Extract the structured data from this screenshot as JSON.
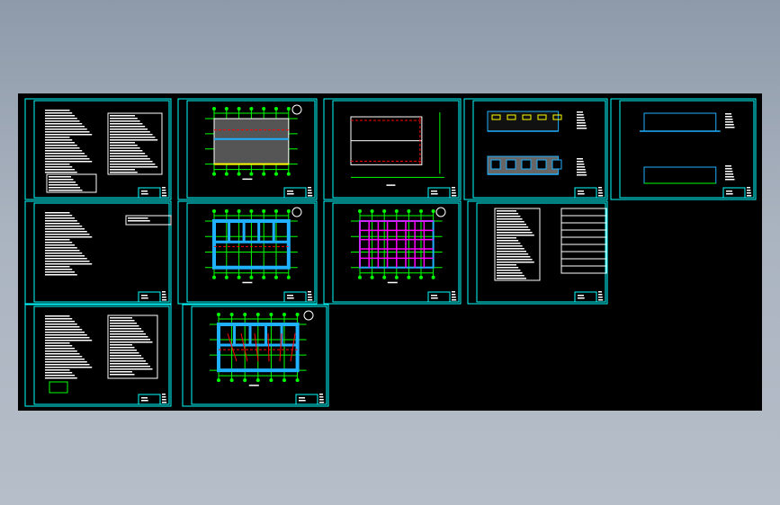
{
  "viewer": {
    "background": "#000000",
    "frame_color": "#00e5ff"
  },
  "colors": {
    "frame": "#00ffff",
    "axis": "#00ff00",
    "wall": "#1fb0ff",
    "text": "#ffffff",
    "hidden": "#ff0000",
    "beam": "#ff00ff",
    "window": "#ffff00"
  },
  "sheets": [
    {
      "kind": "notes"
    },
    {
      "kind": "floor-plan"
    },
    {
      "kind": "roof-plan"
    },
    {
      "kind": "elevation"
    },
    {
      "kind": "section"
    },
    {
      "kind": "notes"
    },
    {
      "kind": "foundation-plan"
    },
    {
      "kind": "beam-plan"
    },
    {
      "kind": "schedule"
    },
    {
      "kind": "notes"
    },
    {
      "kind": "electrical-plan"
    }
  ]
}
